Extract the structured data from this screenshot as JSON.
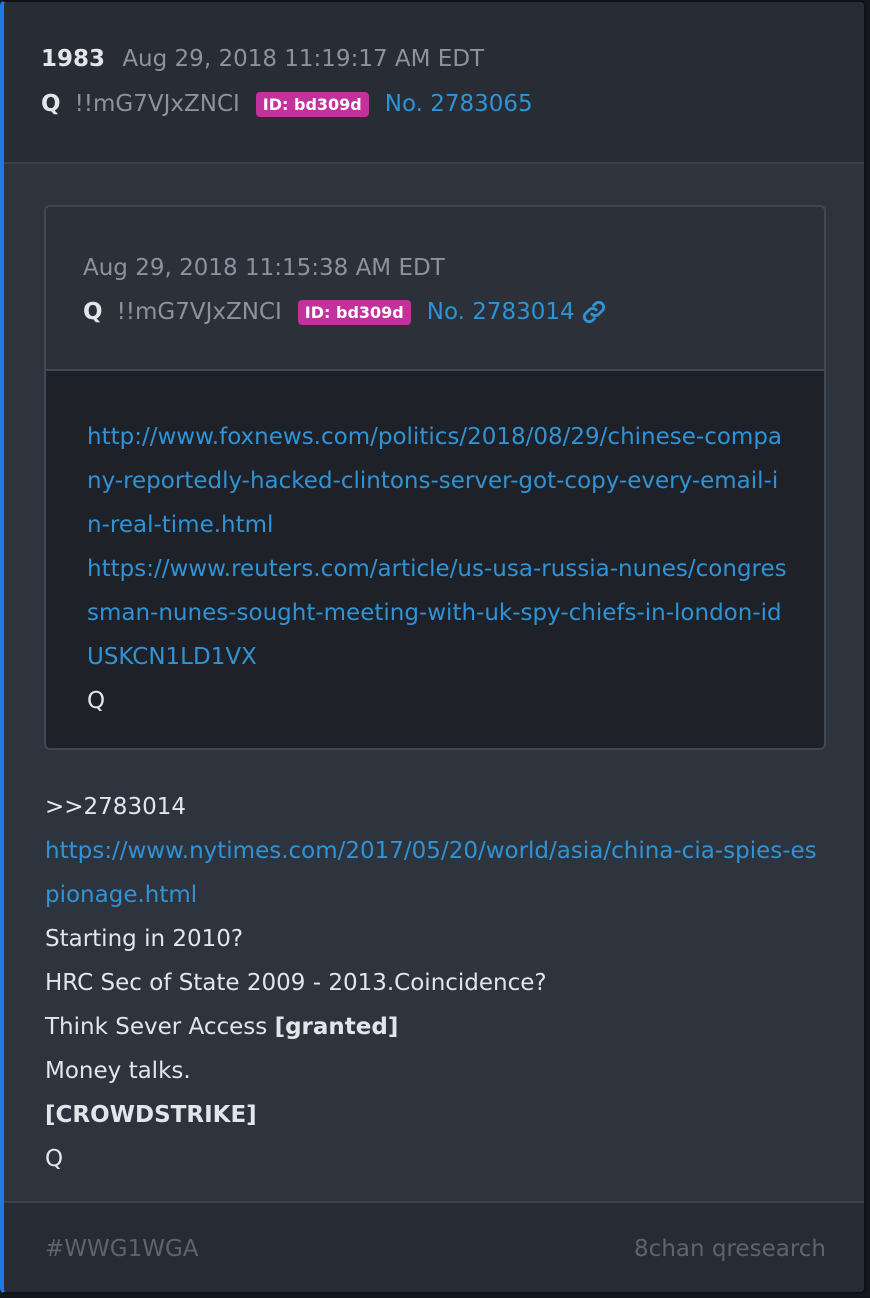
{
  "post": {
    "number": "1983",
    "date": "Aug 29, 2018 11:19:17 AM EDT",
    "author": "Q",
    "tripcode": "!!mG7VJxZNCI",
    "id_badge": "ID: bd309d",
    "post_no": "No. 2783065"
  },
  "quoted": {
    "date": "Aug 29, 2018 11:15:38 AM EDT",
    "author": "Q",
    "tripcode": "!!mG7VJxZNCI",
    "id_badge": "ID: bd309d",
    "post_no": "No. 2783014",
    "link_icon": "link-icon",
    "links": [
      "http://www.foxnews.com/politics/2018/08/29/chinese-company-reportedly-hacked-clintons-server-got-copy-every-email-in-real-time.html",
      "https://www.reuters.com/article/us-usa-russia-nunes/congressman-nunes-sought-meeting-with-uk-spy-chiefs-in-london-idUSKCN1LD1VX"
    ],
    "signature": "Q"
  },
  "body": {
    "reply_ref": ">>2783014",
    "link": "https://www.nytimes.com/2017/05/20/world/asia/china-cia-spies-espionage.html",
    "line1": "Starting in 2010?",
    "line2": "HRC Sec of State 2009 - 2013.Coincidence?",
    "line3_text": "Think Sever Access ",
    "line3_bold": "[granted]",
    "line4": "Money talks.",
    "line5_bold": "[CROWDSTRIKE]",
    "signature": "Q"
  },
  "footer": {
    "hashtag": "#WWG1WGA",
    "source": "8chan qresearch"
  },
  "colors": {
    "accent": "#1e7be6",
    "link": "#2f93d6",
    "id_badge": "#c2319c",
    "background": "#2e343e"
  }
}
